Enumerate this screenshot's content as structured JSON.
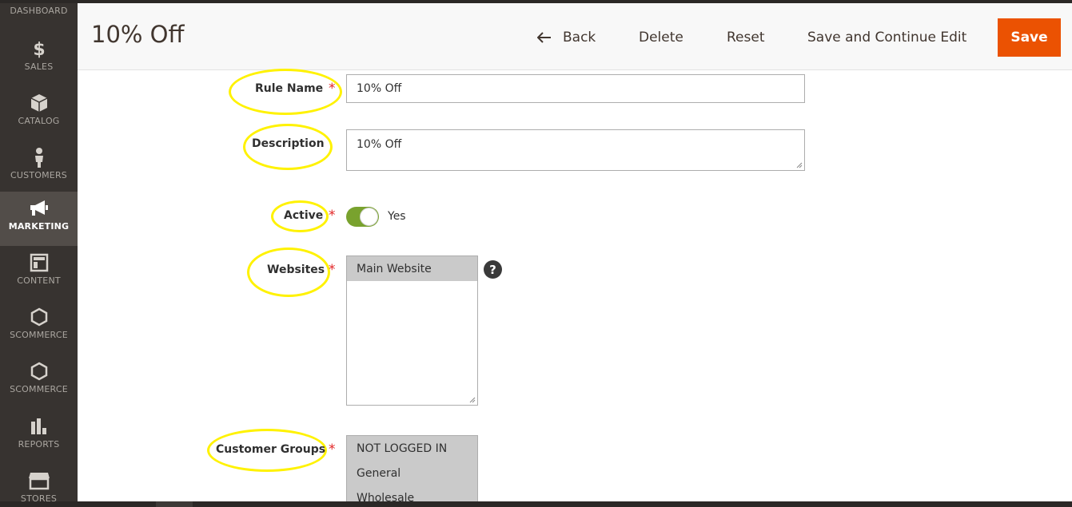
{
  "sidebar": {
    "items": [
      {
        "label": "DASHBOARD",
        "icon": "dashboard-icon"
      },
      {
        "label": "SALES",
        "icon": "dollar-icon"
      },
      {
        "label": "CATALOG",
        "icon": "box-icon"
      },
      {
        "label": "CUSTOMERS",
        "icon": "person-icon"
      },
      {
        "label": "MARKETING",
        "icon": "megaphone-icon",
        "active": true
      },
      {
        "label": "CONTENT",
        "icon": "layout-icon"
      },
      {
        "label": "SCOMMERCE",
        "icon": "hexagon-icon"
      },
      {
        "label": "SCOMMERCE",
        "icon": "hexagon-icon"
      },
      {
        "label": "REPORTS",
        "icon": "bar-chart-icon"
      },
      {
        "label": "STORES",
        "icon": "store-icon"
      }
    ]
  },
  "header": {
    "title": "10% Off",
    "back_label": "Back",
    "delete_label": "Delete",
    "reset_label": "Reset",
    "save_continue_label": "Save and Continue Edit",
    "save_label": "Save"
  },
  "form": {
    "rule_name": {
      "label": "Rule Name",
      "value": "10% Off",
      "required": "*"
    },
    "description": {
      "label": "Description",
      "value": "10% Off"
    },
    "active": {
      "label": "Active",
      "state_text": "Yes",
      "required": "*"
    },
    "websites": {
      "label": "Websites",
      "required": "*",
      "options": [
        "Main Website"
      ],
      "help": "?"
    },
    "customer_groups": {
      "label": "Customer Groups",
      "required": "*",
      "options": [
        "NOT LOGGED IN",
        "General",
        "Wholesale"
      ]
    }
  },
  "colors": {
    "accent": "#eb5202",
    "sidebar_bg": "#373330",
    "toggle_on": "#79a22e",
    "highlight": "#fff200",
    "required": "#e22626"
  }
}
